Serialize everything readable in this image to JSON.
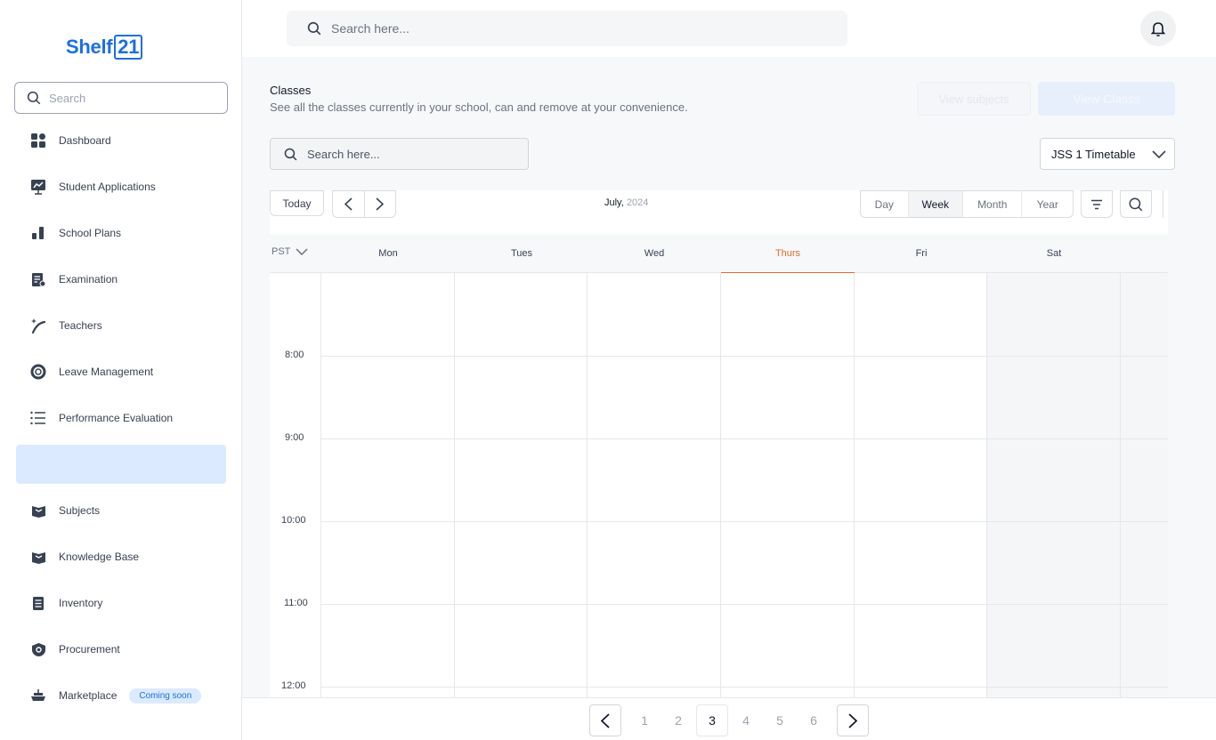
{
  "brand": {
    "name_prefix": "Shelf",
    "name_box": "21",
    "color": "#1d6fe0"
  },
  "sidebar": {
    "search_placeholder": "Search",
    "items": [
      {
        "label": "Dashboard",
        "icon": "grid-icon"
      },
      {
        "label": "Student Applications",
        "icon": "chart-board-icon"
      },
      {
        "label": "School Plans",
        "icon": "bar-chart-icon"
      },
      {
        "label": "Examination",
        "icon": "exam-doc-icon"
      },
      {
        "label": "Teachers",
        "icon": "wand-icon"
      },
      {
        "label": "Leave Management",
        "icon": "lifebuoy-icon"
      },
      {
        "label": "Performance Evaluation",
        "icon": "list-icon"
      },
      {
        "label": "",
        "icon": ""
      },
      {
        "label": "Subjects",
        "icon": "book-icon"
      },
      {
        "label": "Knowledge Base",
        "icon": "book-icon"
      },
      {
        "label": "Inventory",
        "icon": "clipboard-icon"
      },
      {
        "label": "Procurement",
        "icon": "shield-gear-icon"
      },
      {
        "label": "Marketplace",
        "icon": "boat-icon",
        "badge": "Coming soon"
      }
    ]
  },
  "topbar": {
    "search_placeholder": "Search here..."
  },
  "page": {
    "title": "Classes",
    "subtitle": "See all the classes currently in your school, can and remove at your convenience.",
    "btn_subjects": "View subjects",
    "btn_classes": "View Classs",
    "search_placeholder": "Search here...",
    "timetable_select": "JSS 1 Timetable"
  },
  "calendar": {
    "today_label": "Today",
    "month": "July,",
    "year": "2024",
    "views": [
      "Day",
      "Week",
      "Month",
      "Year"
    ],
    "selected_view": "Week",
    "timezone": "PST",
    "days": [
      "Mon",
      "Tues",
      "Wed",
      "Thurs",
      "Fri",
      "Sat"
    ],
    "today_day": "Thurs",
    "times": [
      "8:00",
      "9:00",
      "10:00",
      "11:00",
      "12:00"
    ],
    "accent": "#e26b2a"
  },
  "pagination": {
    "pages": [
      "1",
      "2",
      "3",
      "4",
      "5",
      "6"
    ],
    "current": "3"
  }
}
